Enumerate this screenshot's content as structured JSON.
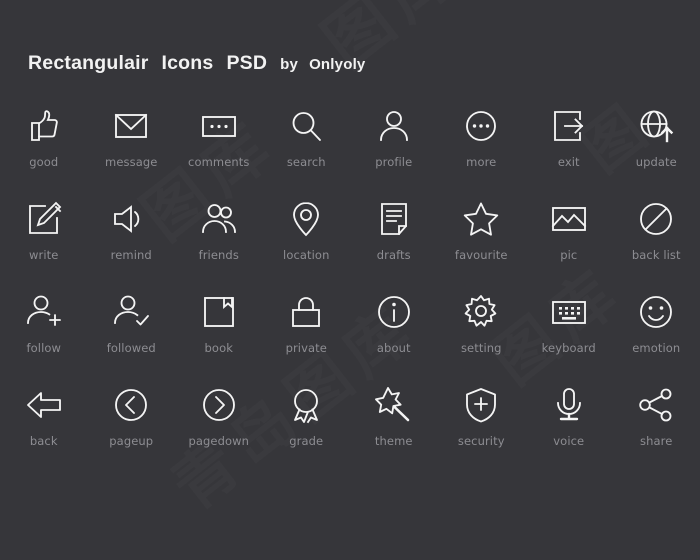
{
  "background_color": "#36363a",
  "icon_color": "#f4f4f4",
  "label_color": "#8d8d92",
  "title": {
    "part1": "Rectangulair",
    "part2": "Icons",
    "part3": "PSD",
    "by": "by",
    "author": "Onlyoly"
  },
  "watermark": {
    "text1": "图库",
    "text2": "图库",
    "text3": "图库",
    "text4": "青岛图库",
    "text5": "图"
  },
  "rows": [
    {
      "cells": [
        {
          "label": "good",
          "icon": "thumbs-up-icon"
        },
        {
          "label": "message",
          "icon": "envelope-icon"
        },
        {
          "label": "comments",
          "icon": "comments-box-icon"
        },
        {
          "label": "search",
          "icon": "magnifier-icon"
        },
        {
          "label": "profile",
          "icon": "person-icon"
        },
        {
          "label": "more",
          "icon": "more-dots-circle-icon"
        },
        {
          "label": "exit",
          "icon": "exit-arrow-icon"
        },
        {
          "label": "update",
          "icon": "globe-upload-icon"
        }
      ]
    },
    {
      "cells": [
        {
          "label": "write",
          "icon": "pencil-square-icon"
        },
        {
          "label": "remind",
          "icon": "speaker-icon"
        },
        {
          "label": "friends",
          "icon": "two-people-icon"
        },
        {
          "label": "location",
          "icon": "map-pin-icon"
        },
        {
          "label": "drafts",
          "icon": "document-icon"
        },
        {
          "label": "favourite",
          "icon": "star-icon"
        },
        {
          "label": "pic",
          "icon": "image-mountain-icon"
        },
        {
          "label": "back list",
          "icon": "prohibition-icon"
        }
      ]
    },
    {
      "cells": [
        {
          "label": "follow",
          "icon": "person-plus-icon"
        },
        {
          "label": "followed",
          "icon": "person-check-icon"
        },
        {
          "label": "book",
          "icon": "book-corner-icon"
        },
        {
          "label": "private",
          "icon": "padlock-icon"
        },
        {
          "label": "about",
          "icon": "info-circle-icon"
        },
        {
          "label": "setting",
          "icon": "gear-icon"
        },
        {
          "label": "keyboard",
          "icon": "keyboard-icon"
        },
        {
          "label": "emotion",
          "icon": "smiley-face-icon"
        }
      ]
    },
    {
      "cells": [
        {
          "label": "back",
          "icon": "back-arrow-icon"
        },
        {
          "label": "pageup",
          "icon": "chevron-left-circle-icon"
        },
        {
          "label": "pagedown",
          "icon": "chevron-right-circle-icon"
        },
        {
          "label": "grade",
          "icon": "award-medal-icon"
        },
        {
          "label": "theme",
          "icon": "magic-wand-star-icon"
        },
        {
          "label": "security",
          "icon": "shield-plus-icon"
        },
        {
          "label": "voice",
          "icon": "microphone-icon"
        },
        {
          "label": "share",
          "icon": "share-nodes-icon"
        }
      ]
    }
  ]
}
